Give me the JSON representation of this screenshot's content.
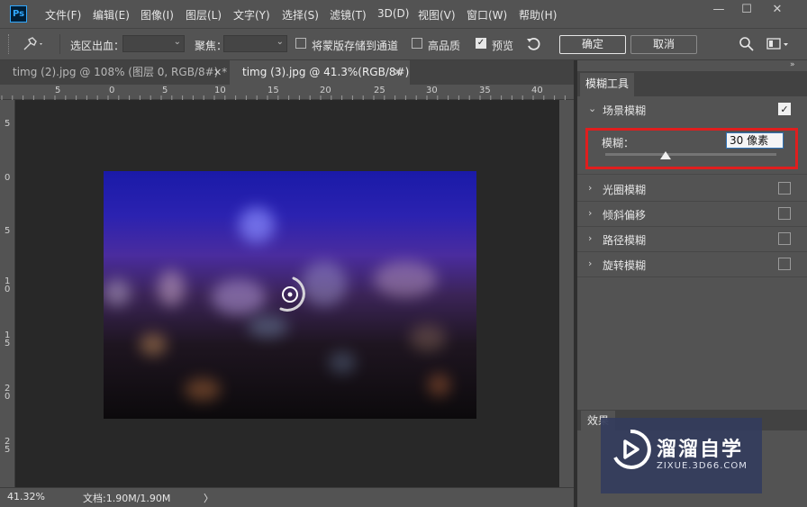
{
  "app": {
    "logo": "Ps"
  },
  "menu": [
    "文件(F)",
    "编辑(E)",
    "图像(I)",
    "图层(L)",
    "文字(Y)",
    "选择(S)",
    "滤镜(T)",
    "3D(D)",
    "视图(V)",
    "窗口(W)",
    "帮助(H)"
  ],
  "window_controls": {
    "minimize": "—",
    "maximize": "☐",
    "close": "✕"
  },
  "options": {
    "selection_bleed_label": "选区出血：",
    "focus_label": "聚焦：",
    "save_mask_label": "将蒙版存储到通道",
    "save_mask_checked": false,
    "high_quality_label": "高品质",
    "high_quality_checked": false,
    "preview_label": "预览",
    "preview_checked": true,
    "ok_label": "确定",
    "cancel_label": "取消"
  },
  "tabs": [
    {
      "title": "timg (2).jpg @ 108% (图层 0, RGB/8#) *",
      "active": false
    },
    {
      "title": "timg (3).jpg @ 41.3%(RGB/8#)",
      "active": true
    }
  ],
  "ruler_top": [
    "5",
    "0",
    "5",
    "10",
    "15",
    "20",
    "25",
    "30",
    "35",
    "40"
  ],
  "ruler_left": [
    "5",
    "0",
    "5",
    "10",
    "15",
    "20",
    "25"
  ],
  "status": {
    "zoom": "41.32%",
    "doc": "文档:1.90M/1.90M",
    "arrow": "〉"
  },
  "panel": {
    "tab": "模糊工具",
    "sections": [
      {
        "label": "场景模糊",
        "expanded": true,
        "checked": true
      },
      {
        "label": "光圈模糊",
        "expanded": false,
        "checked": false
      },
      {
        "label": "倾斜偏移",
        "expanded": false,
        "checked": false
      },
      {
        "label": "路径模糊",
        "expanded": false,
        "checked": false
      },
      {
        "label": "旋转模糊",
        "expanded": false,
        "checked": false
      }
    ],
    "blur_label": "模糊：",
    "blur_value": "30 像素",
    "blur_slider_fraction": 0.35,
    "bottom_tab": "效果"
  },
  "watermark": {
    "title": "溜溜自学",
    "url": "ZIXUE.3D66.COM"
  },
  "colors": {
    "highlight": "#e01e1e",
    "ps_blue": "#31a8ff"
  }
}
